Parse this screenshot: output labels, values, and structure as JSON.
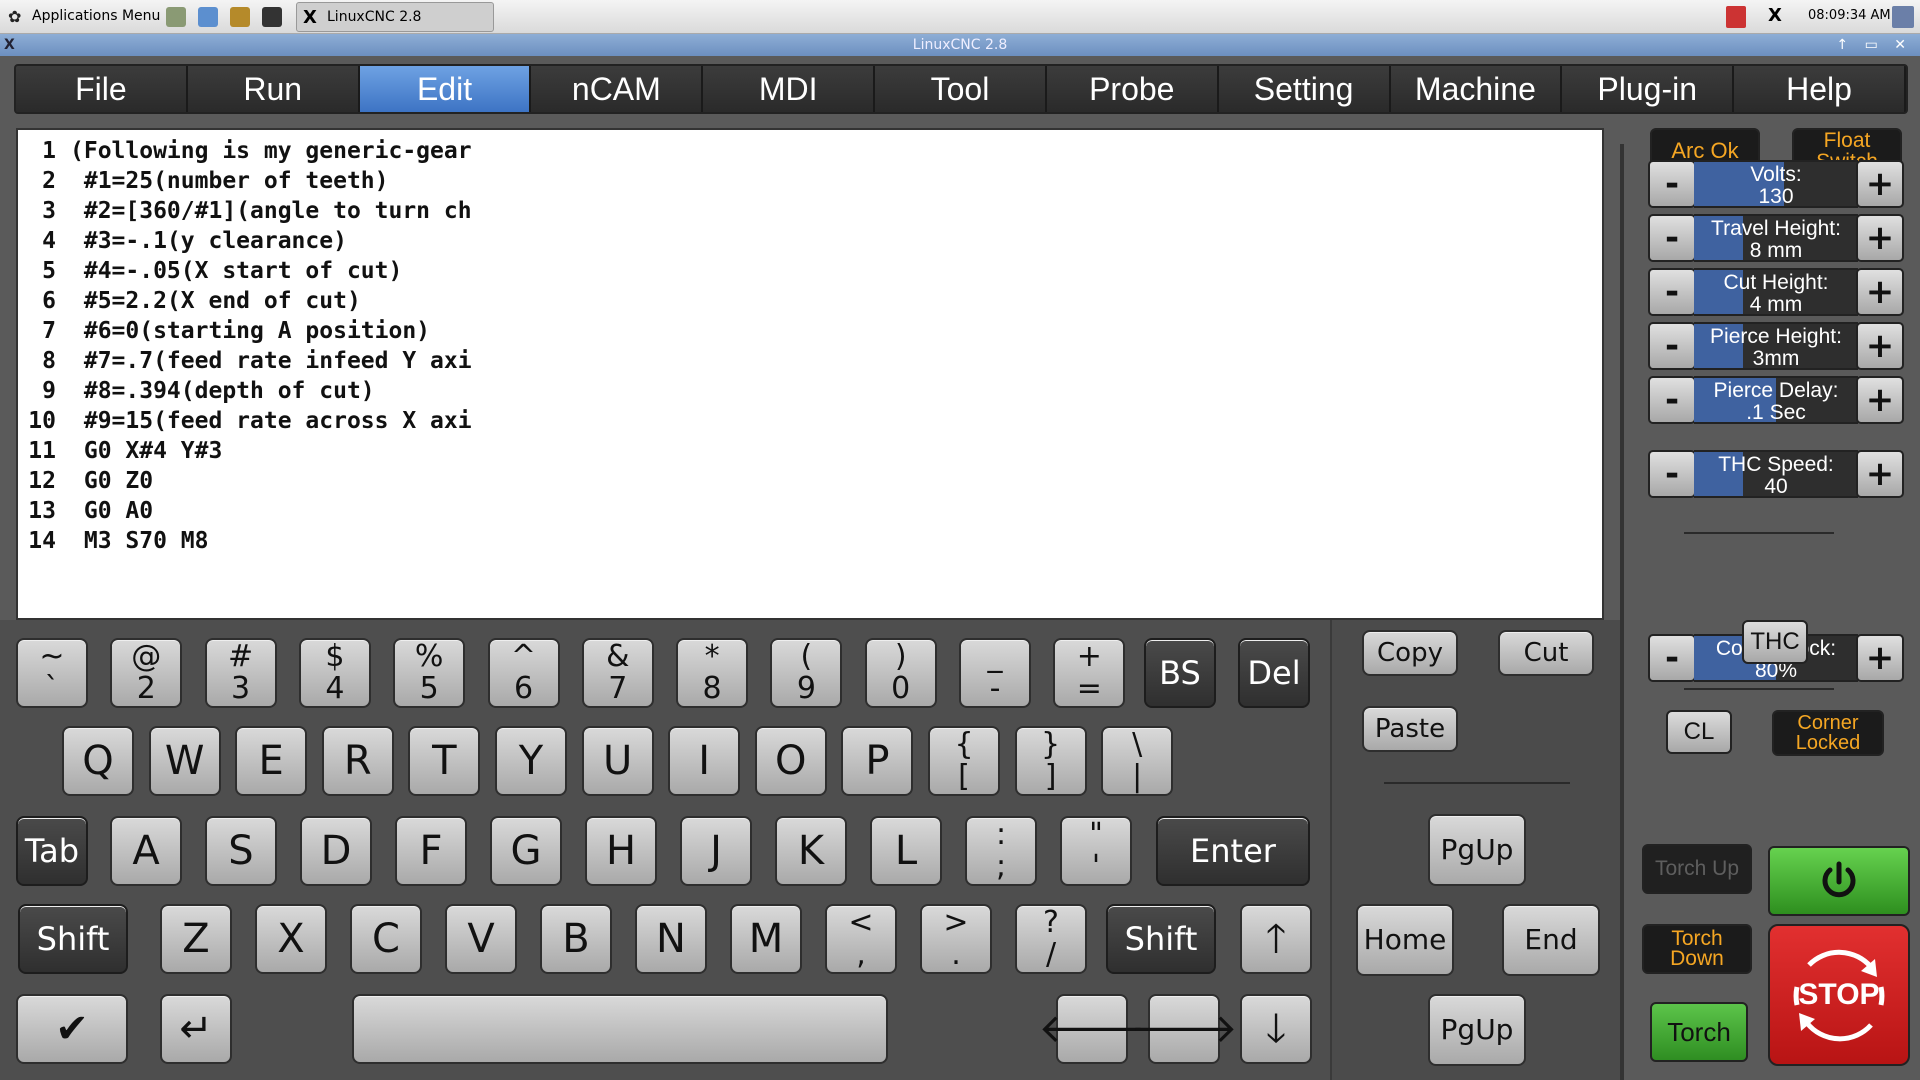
{
  "taskbar": {
    "apps_menu": "Applications Menu",
    "window_button": "LinuxCNC 2.8",
    "clock": "08:09:34 AM"
  },
  "window": {
    "title": "LinuxCNC 2.8"
  },
  "menu": [
    "File",
    "Run",
    "Edit",
    "nCAM",
    "MDI",
    "Tool",
    "Probe",
    "Setting",
    "Machine",
    "Plug-in",
    "Help"
  ],
  "menu_active": "Edit",
  "editor": {
    "lines": [
      {
        "n": "1",
        "t": "(Following is my generic-gear"
      },
      {
        "n": "2",
        "t": " #1=25(number of teeth)"
      },
      {
        "n": "3",
        "t": " #2=[360/#1](angle to turn ch"
      },
      {
        "n": "4",
        "t": " #3=-.1(y clearance)"
      },
      {
        "n": "5",
        "t": " #4=-.05(X start of cut)"
      },
      {
        "n": "6",
        "t": " #5=2.2(X end of cut)"
      },
      {
        "n": "7",
        "t": " #6=0(starting A position)"
      },
      {
        "n": "8",
        "t": " #7=.7(feed rate infeed Y axi"
      },
      {
        "n": "9",
        "t": " #8=.394(depth of cut)"
      },
      {
        "n": "10",
        "t": " #9=15(feed rate across X axi"
      },
      {
        "n": "11",
        "t": " G0 X#4 Y#3"
      },
      {
        "n": "12",
        "t": " G0 Z0"
      },
      {
        "n": "13",
        "t": " G0 A0"
      },
      {
        "n": "14",
        "t": " M3 S70 M8"
      }
    ]
  },
  "keyboard": {
    "row1": [
      [
        "~",
        "`"
      ],
      [
        "@",
        "2"
      ],
      [
        "#",
        "3"
      ],
      [
        "$",
        "4"
      ],
      [
        "%",
        "5"
      ],
      [
        "^",
        "6"
      ],
      [
        "&",
        "7"
      ],
      [
        "*",
        "8"
      ],
      [
        "(",
        "9"
      ],
      [
        ")",
        "0"
      ],
      [
        "_",
        "-"
      ],
      [
        "+",
        "="
      ]
    ],
    "bs": "BS",
    "del": "Del",
    "row2": [
      "Q",
      "W",
      "E",
      "R",
      "T",
      "Y",
      "U",
      "I",
      "O",
      "P"
    ],
    "row2_sym": [
      [
        "{",
        "["
      ],
      [
        "}",
        "]"
      ],
      [
        "\\",
        "|"
      ]
    ],
    "tab": "Tab",
    "row3": [
      "A",
      "S",
      "D",
      "F",
      "G",
      "H",
      "J",
      "K",
      "L"
    ],
    "row3_sym": [
      [
        ":",
        ";"
      ],
      [
        "\"",
        "'"
      ]
    ],
    "enter": "Enter",
    "shift": "Shift",
    "row4": [
      "Z",
      "X",
      "C",
      "V",
      "B",
      "N",
      "M"
    ],
    "row4_sym": [
      [
        "<",
        ","
      ],
      [
        ">",
        "."
      ],
      [
        "?",
        "/"
      ]
    ],
    "up": "🡑",
    "left": "🡐",
    "right": "🡒",
    "down": "🡓",
    "check": "✔",
    "return": "↵"
  },
  "nav": {
    "copy": "Copy",
    "cut": "Cut",
    "paste": "Paste",
    "pgup1": "PgUp",
    "home": "Home",
    "end": "End",
    "pgup2": "PgUp"
  },
  "plasma": {
    "arc_ok": "Arc Ok",
    "float_switch": "Float Switch",
    "volts": {
      "label": "Volts:",
      "value": "130",
      "fill": 0.55
    },
    "travel_height": {
      "label": "Travel Height:",
      "value": "8 mm",
      "fill": 0.3
    },
    "cut_height": {
      "label": "Cut Height:",
      "value": "4 mm",
      "fill": 0.3
    },
    "pierce_height": {
      "label": "Pierce Height:",
      "value": "3mm",
      "fill": 0.3
    },
    "pierce_delay": {
      "label": "Pierce Delay:",
      "value": ".1 Sec",
      "fill": 0.5
    },
    "thc_speed": {
      "label": "THC Speed:",
      "value": "40",
      "fill": 0.3
    },
    "thc": "THC",
    "cl": "CL",
    "corner_locked": "Corner Locked",
    "corner_lock": {
      "label": "Corner Lock:",
      "value": "80%",
      "fill": 0.5
    },
    "torch_up": "Torch Up",
    "torch_down": "Torch Down",
    "torch": "Torch",
    "stop": "STOP",
    "colors": {
      "accent_orange": "#f5a623",
      "green": "#3fa82c",
      "red": "#d42020",
      "menu_active": "#4d84d0"
    }
  }
}
